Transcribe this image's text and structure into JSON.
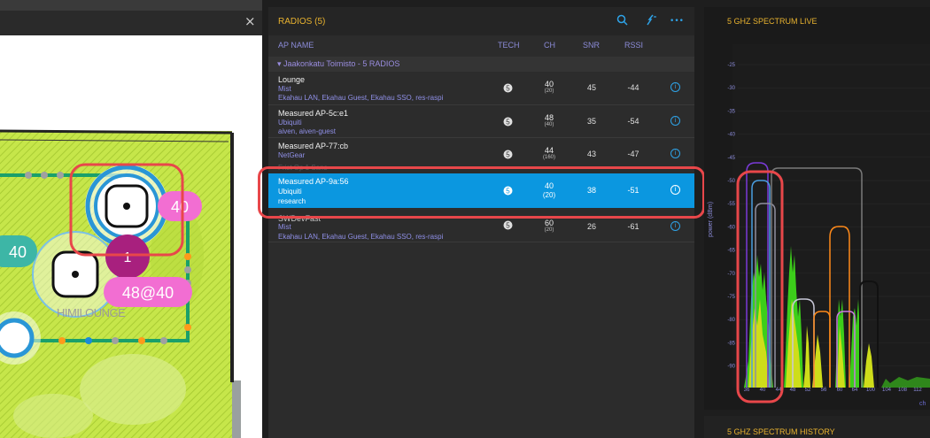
{
  "map": {
    "close_glyph": "×",
    "area_label": "HIMILOUNGE",
    "badges": [
      {
        "id": "badge-40-top",
        "text": "40"
      },
      {
        "id": "badge-40-left",
        "text": "40"
      },
      {
        "id": "badge-1",
        "text": "1"
      },
      {
        "id": "badge-48-40",
        "text": "48@40"
      }
    ]
  },
  "radios": {
    "title": "RADIOS (5)",
    "icons": [
      "search-icon",
      "filter-icon",
      "more-icon"
    ],
    "more_glyph": "•••",
    "columns": {
      "ap_name": "AP NAME",
      "tech": "TECH",
      "ch": "CH",
      "snr": "SNR",
      "rssi": "RSSI"
    },
    "group_label": "▾ Jaakonkatu Toimisto - 5 RADIOS",
    "ghost_label": "Frist Op 1 Sans",
    "info_glyph": "i",
    "rows": [
      {
        "name": "Lounge",
        "vendor": "Mist",
        "ssid": "Ekahau LAN, Ekahau Guest, Ekahau SSO, res-raspi",
        "ch": "40",
        "width": "(20)",
        "snr": "45",
        "rssi": "-44"
      },
      {
        "name": "Measured AP-5c:e1",
        "vendor": "Ubiquiti",
        "ssid": "aiven, aiven-guest",
        "ch": "48",
        "width": "(40)",
        "snr": "35",
        "rssi": "-54"
      },
      {
        "name": "Measured AP-77:cb",
        "vendor": "NetGear",
        "ssid": "",
        "ch": "44",
        "width": "(160)",
        "snr": "43",
        "rssi": "-47"
      },
      {
        "name": "Measured AP-9a:56",
        "vendor": "Ubiquiti",
        "ssid": "research",
        "ch": "40",
        "width": "(20)",
        "snr": "38",
        "rssi": "-51"
      },
      {
        "name": "SWDevFast",
        "vendor": "Mist",
        "ssid": "Ekahau LAN, Ekahau Guest, Ekahau SSO, res-raspi",
        "ch": "60",
        "width": "(20)",
        "snr": "26",
        "rssi": "-61"
      }
    ],
    "selected_index": 3
  },
  "spectrum": {
    "title": "5 GHZ SPECTRUM LIVE",
    "history_title": "5 GHZ SPECTRUM HISTORY",
    "y_label": "power (dBm)",
    "x_label_partial": "ch",
    "y_ticks": [
      "-25",
      "-30",
      "-35",
      "-40",
      "-45",
      "-50",
      "-55",
      "-60",
      "-65",
      "-70",
      "-75",
      "-80",
      "-85",
      "-90"
    ],
    "x_ticks": [
      "36",
      "40",
      "44",
      "48",
      "52",
      "56",
      "60",
      "64",
      "100",
      "104",
      "108",
      "112",
      "116"
    ]
  },
  "colors": {
    "accent": "#e8b22f",
    "selection": "#0b97e0",
    "highlight": "#e8474a",
    "link": "#2ea3e8"
  }
}
